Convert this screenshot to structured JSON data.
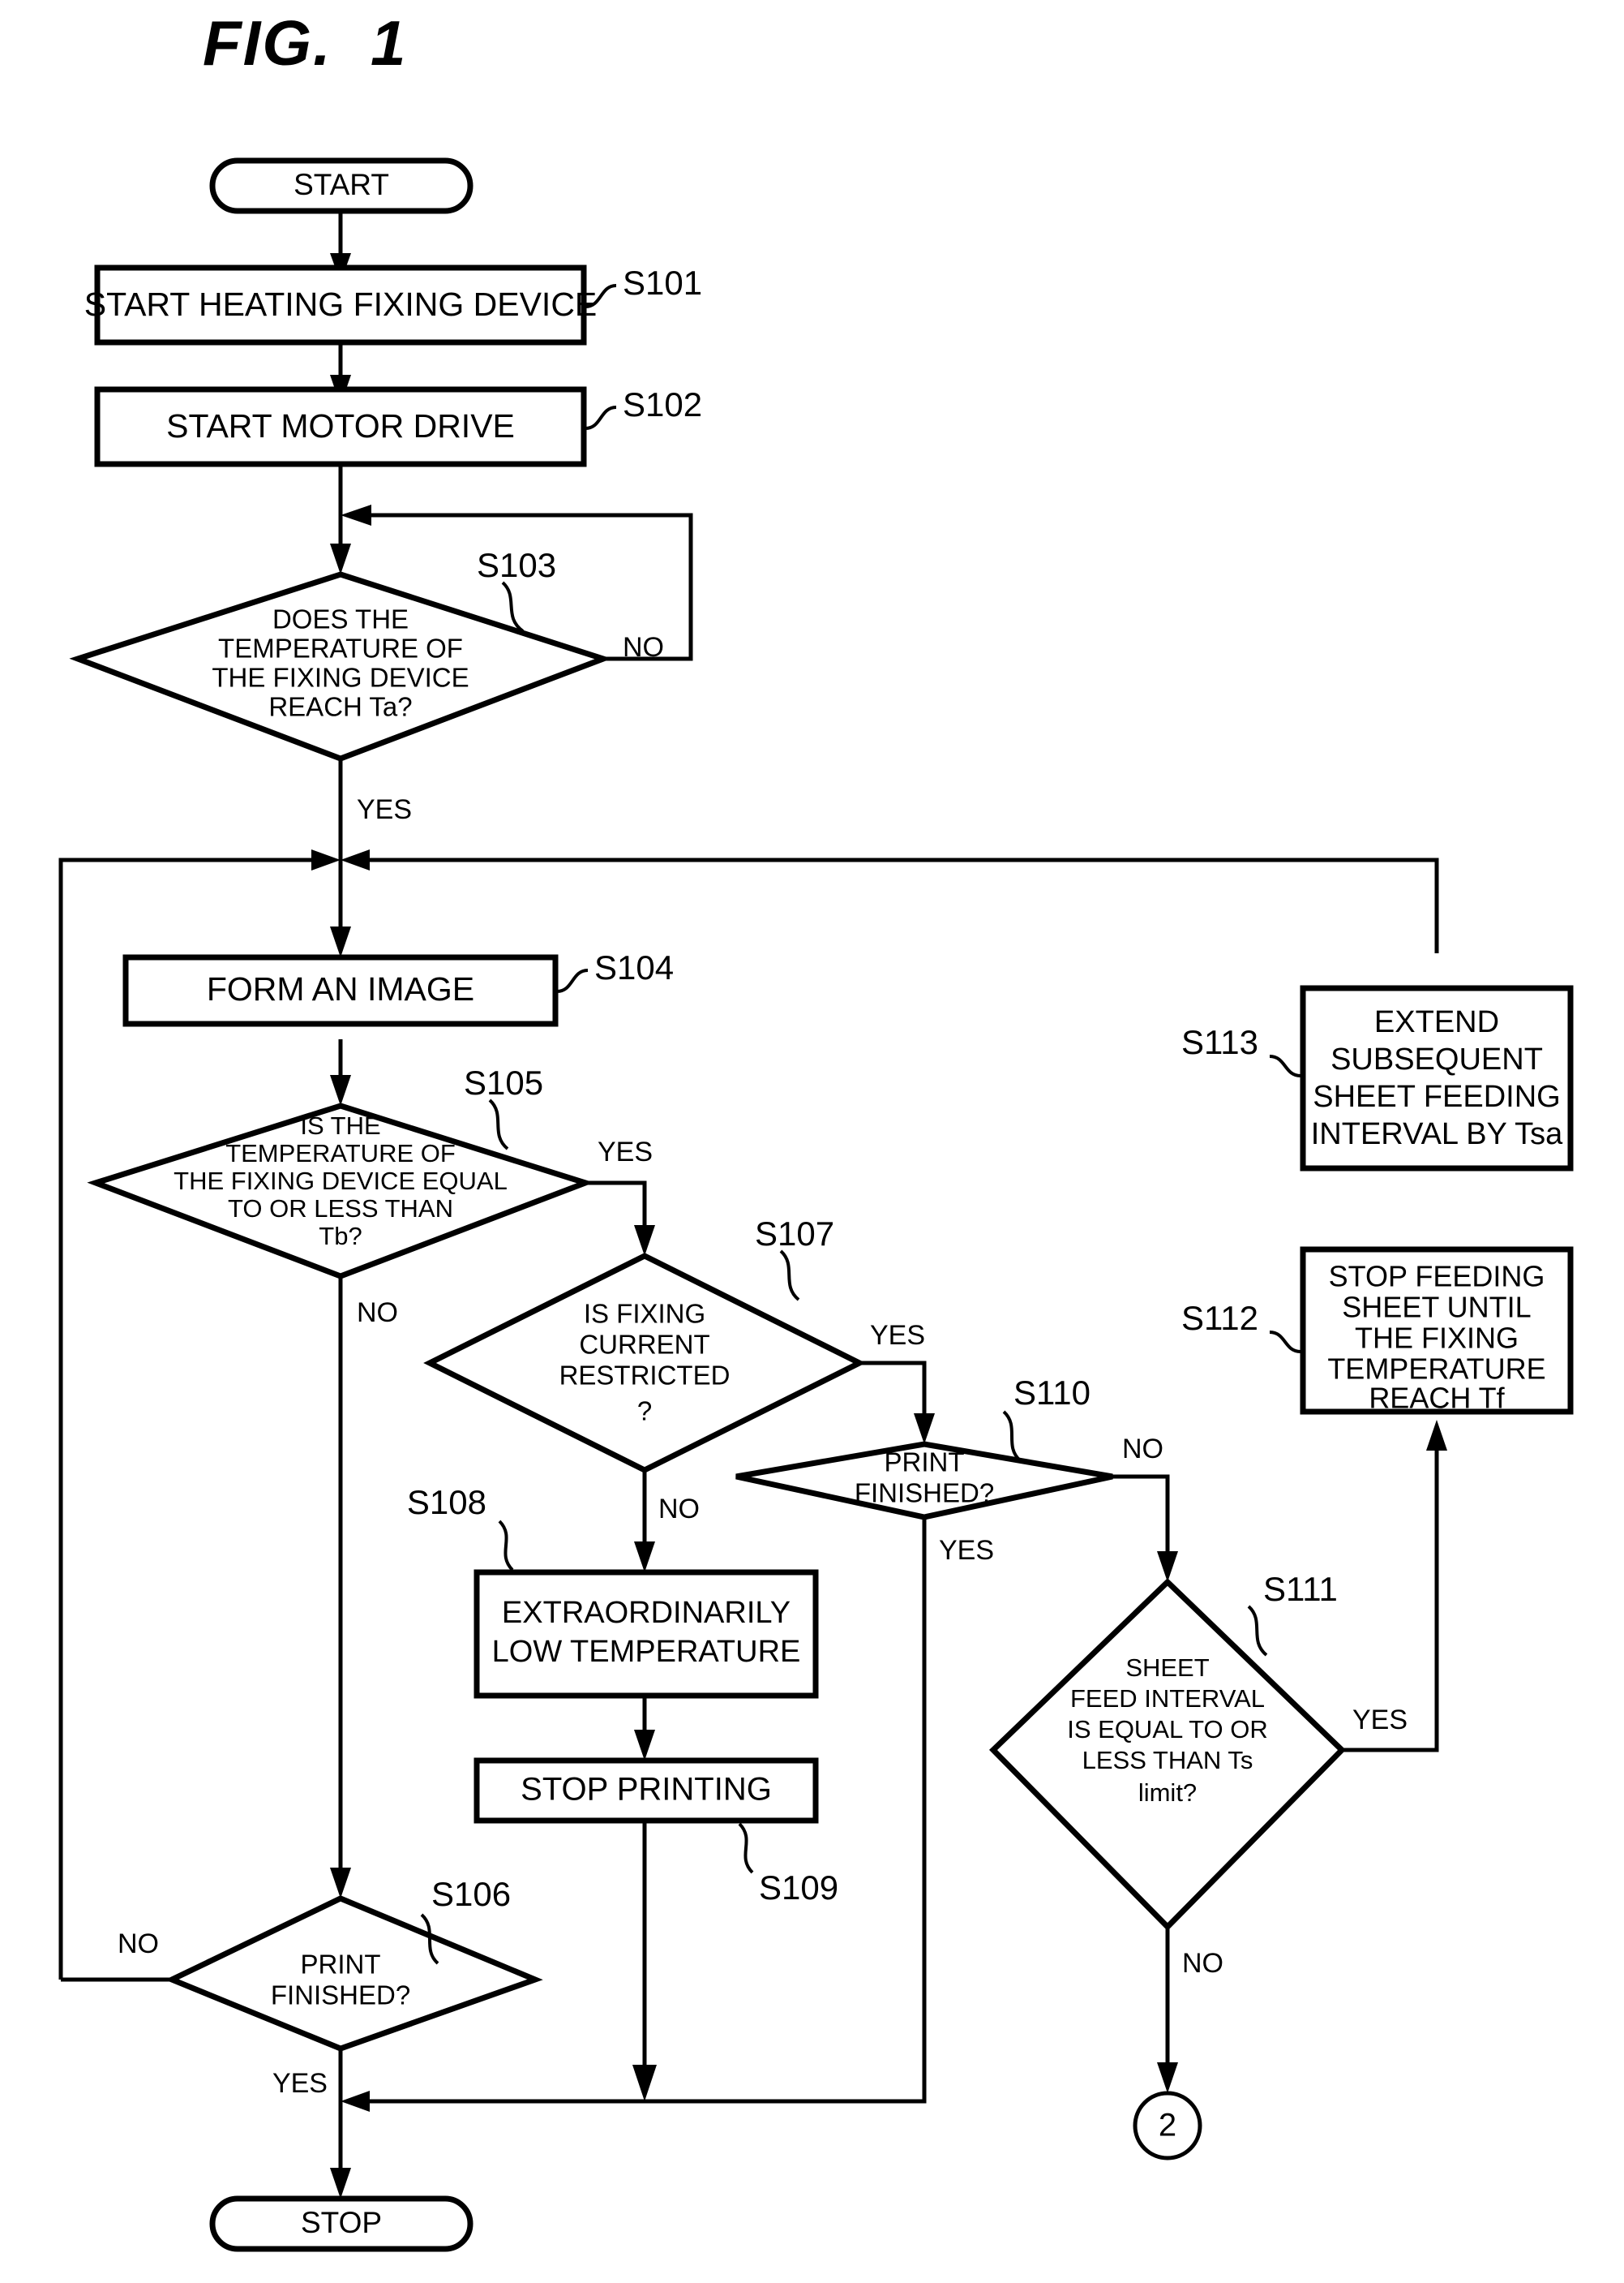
{
  "figure": {
    "title": "FIG.  1"
  },
  "nodes": {
    "start": {
      "label": "START"
    },
    "s101": {
      "step": "S101",
      "label": "START HEATING FIXING DEVICE"
    },
    "s102": {
      "step": "S102",
      "label": "START MOTOR DRIVE"
    },
    "s103": {
      "step": "S103",
      "lines": [
        "DOES THE",
        "TEMPERATURE OF",
        "THE FIXING DEVICE",
        "REACH Ta?"
      ],
      "yes": "YES",
      "no": "NO"
    },
    "s104": {
      "step": "S104",
      "label": "FORM AN IMAGE"
    },
    "s105": {
      "step": "S105",
      "lines": [
        "IS THE",
        "TEMPERATURE OF",
        "THE FIXING DEVICE EQUAL",
        "TO OR LESS THAN",
        "Tb?"
      ],
      "yes": "YES",
      "no": "NO"
    },
    "s106": {
      "step": "S106",
      "lines": [
        "PRINT",
        "FINISHED?"
      ],
      "yes": "YES",
      "no": "NO"
    },
    "s107": {
      "step": "S107",
      "lines": [
        "IS FIXING",
        "CURRENT",
        "RESTRICTED",
        "?"
      ],
      "yes": "YES",
      "no": "NO"
    },
    "s108": {
      "step": "S108",
      "lines": [
        "EXTRAORDINARILY",
        "LOW TEMPERATURE"
      ]
    },
    "s109": {
      "step": "S109",
      "label": "STOP PRINTING"
    },
    "s110": {
      "step": "S110",
      "lines": [
        "PRINT",
        "FINISHED?"
      ],
      "yes": "YES",
      "no": "NO"
    },
    "s111": {
      "step": "S111",
      "lines": [
        "SHEET",
        "FEED INTERVAL",
        "IS EQUAL TO OR",
        "LESS THAN Ts",
        "limit?"
      ],
      "yes": "YES",
      "no": "NO"
    },
    "s112": {
      "step": "S112",
      "lines": [
        "STOP FEEDING",
        "SHEET UNTIL",
        "THE FIXING",
        "TEMPERATURE",
        "REACH Tf"
      ]
    },
    "s113": {
      "step": "S113",
      "lines": [
        "EXTEND",
        "SUBSEQUENT",
        "SHEET FEEDING",
        "INTERVAL BY Tsa"
      ]
    },
    "stop": {
      "label": "STOP"
    },
    "offpage": {
      "label": "2"
    }
  },
  "colors": {
    "stroke": "#000000",
    "background": "#ffffff"
  }
}
